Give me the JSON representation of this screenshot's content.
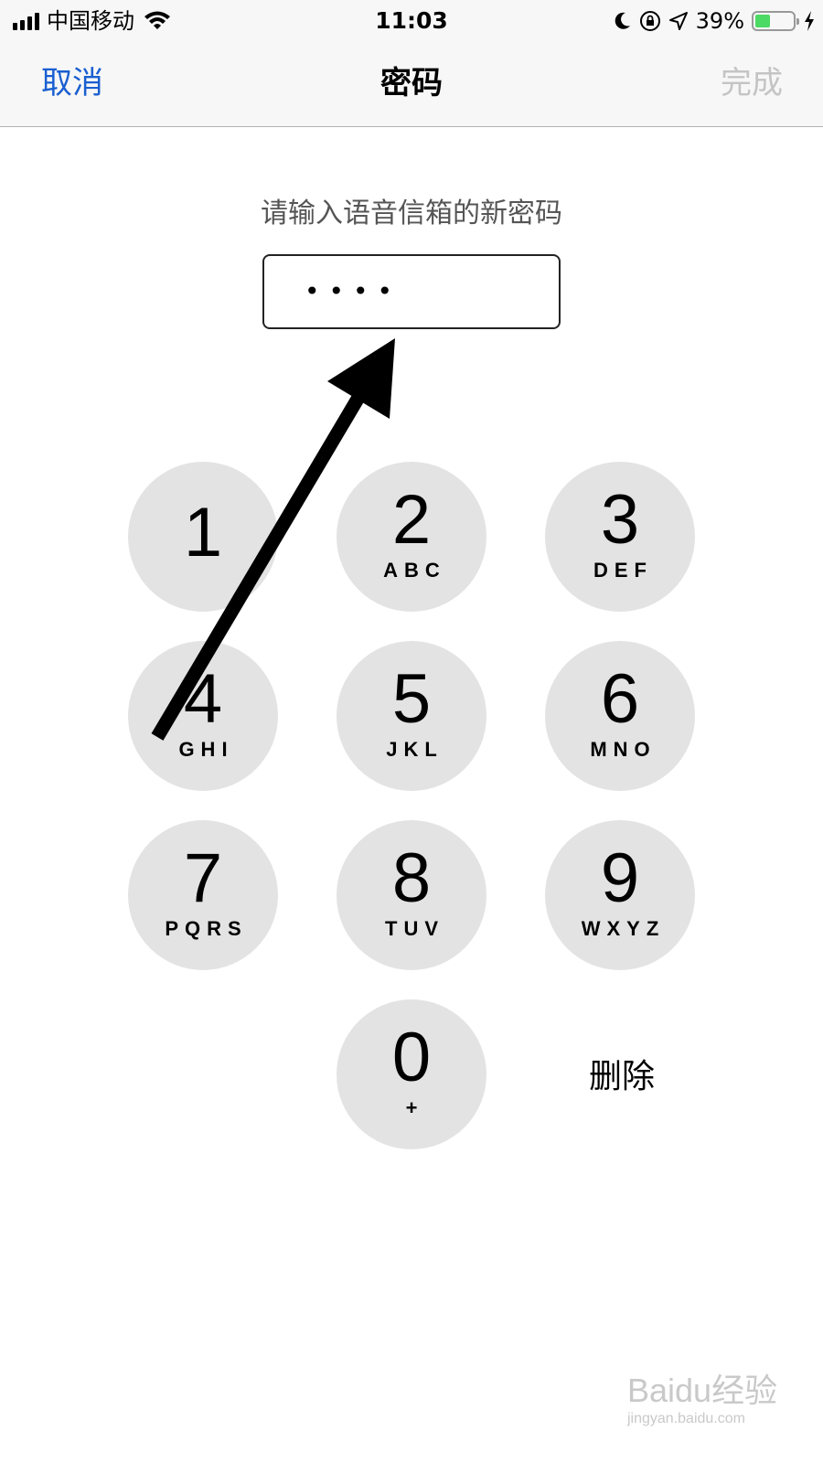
{
  "status_bar": {
    "carrier": "中国移动",
    "time": "11:03",
    "battery_percent": "39%",
    "battery_level": 0.39,
    "icons": [
      "signal-icon",
      "wifi-icon",
      "moon-icon",
      "orientation-lock-icon",
      "location-icon",
      "battery-icon",
      "charging-icon"
    ]
  },
  "nav": {
    "cancel_label": "取消",
    "title": "密码",
    "done_label": "完成"
  },
  "prompt": "请输入语音信箱的新密码",
  "password": {
    "masked_value": "••••"
  },
  "keypad": {
    "keys": [
      {
        "digit": "1",
        "letters": ""
      },
      {
        "digit": "2",
        "letters": "ABC"
      },
      {
        "digit": "3",
        "letters": "DEF"
      },
      {
        "digit": "4",
        "letters": "GHI"
      },
      {
        "digit": "5",
        "letters": "JKL"
      },
      {
        "digit": "6",
        "letters": "MNO"
      },
      {
        "digit": "7",
        "letters": "PQRS"
      },
      {
        "digit": "8",
        "letters": "TUV"
      },
      {
        "digit": "9",
        "letters": "WXYZ"
      },
      {
        "digit": "0",
        "letters": "+"
      }
    ],
    "delete_label": "删除"
  },
  "watermark": {
    "main": "Baidu经验",
    "sub": "jingyan.baidu.com"
  },
  "colors": {
    "accent_blue": "#1a5fd0",
    "disabled_gray": "#c4c4c4",
    "key_background": "#e3e3e3",
    "battery_green": "#4cd964"
  }
}
